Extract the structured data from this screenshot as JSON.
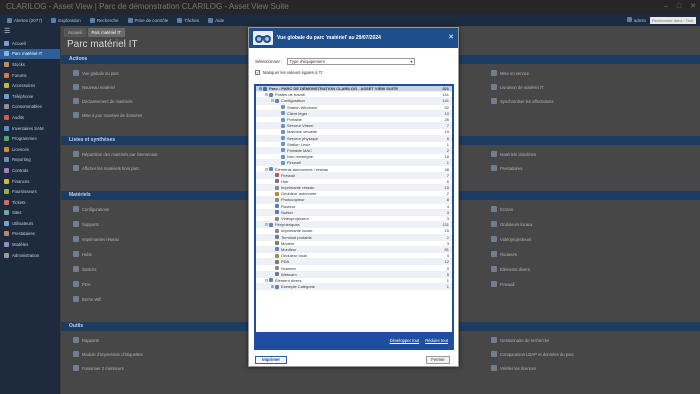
{
  "window": {
    "title": "CLARILOG - Asset View | Parc de démonstration CLARILOG - Asset View Suite"
  },
  "toolbar": {
    "items": [
      "Alertes (2077)",
      "Exploration",
      "Recherche",
      "Prise de contrôle",
      "Tâches",
      "Aide"
    ],
    "user": "admin",
    "search_placeholder": "Rechercher dans : Tout élément"
  },
  "sidebar": {
    "items": [
      {
        "label": "Accueil",
        "color": "#7f9cc0"
      },
      {
        "label": "Parc matériel IT",
        "color": "#8ab0dd"
      },
      {
        "label": "Stocks",
        "color": "#c08a5a"
      },
      {
        "label": "Forums",
        "color": "#d07a45"
      },
      {
        "label": "Accessoires",
        "color": "#c9b14a"
      },
      {
        "label": "Téléphonie",
        "color": "#6aa0c9"
      },
      {
        "label": "Consommables",
        "color": "#8f8f8f"
      },
      {
        "label": "Audits",
        "color": "#cc5c4f"
      },
      {
        "label": "Inventaires SAM",
        "color": "#5e8fc4"
      },
      {
        "label": "Programmes",
        "color": "#5f9f6f"
      },
      {
        "label": "Licences",
        "color": "#c88f3a"
      },
      {
        "label": "Reporting",
        "color": "#6b8fb8"
      },
      {
        "label": "Contrats",
        "color": "#a07fc1"
      },
      {
        "label": "Finances",
        "color": "#d1b34c"
      },
      {
        "label": "Fournisseurs",
        "color": "#8fb05a"
      },
      {
        "label": "Tickets",
        "color": "#cf6b6b"
      },
      {
        "label": "Sites",
        "color": "#6fa7a7"
      },
      {
        "label": "Utilisateurs",
        "color": "#7d9fc8"
      },
      {
        "label": "Prestataires",
        "color": "#b38a6a"
      },
      {
        "label": "Modèles",
        "color": "#8d8dbf"
      },
      {
        "label": "Administration",
        "color": "#9a9a9a"
      }
    ]
  },
  "main": {
    "tabs": [
      "Accueil",
      "Parc matériel IT"
    ],
    "title": "Parc matériel IT",
    "sections": [
      {
        "title": "Actions",
        "left": [
          "Vue globale du parc",
          "Nouveau matériel",
          "Déclassement de matériels",
          "Mise à jour massive de données"
        ],
        "right": [
          "Mise en service",
          "Livraison de matériel IT",
          "Synchroniser les affectations"
        ]
      },
      {
        "title": "Listes et synthèses",
        "left": [
          "Répartition des matériels par intervenant",
          "Afficher les matériels hors parc"
        ],
        "right": [
          "Matériels obsolètes",
          "Prestataires"
        ]
      },
      {
        "title": "Matériels",
        "left": [
          "Configurations",
          "Supports",
          "Imprimantes réseau",
          "Hubs",
          "Switchs",
          "PDA",
          "Borne Wifi"
        ],
        "right": [
          "Écrans",
          "Onduleurs locaux",
          "Vidéoprojecteurs",
          "Routeurs",
          "Éléments divers",
          "Firewall"
        ]
      },
      {
        "title": "Outils",
        "left": [
          "Rapports",
          "Module d'impression d'étiquettes",
          "Fusionner 2 moniteurs"
        ],
        "right": [
          "Gestionnaire de recherche",
          "Comparaison LDAP et données du parc",
          "Vérifier les licences"
        ]
      }
    ]
  },
  "modal": {
    "title": "Vue globale du parc 'matériel' au 29/07/2024",
    "select_label": "Sélectionner :",
    "select_value": "Type d'équipement",
    "checkbox_label": "Masquer les valeurs égales à '0'",
    "checkbox_checked": true,
    "tree": [
      {
        "level": 0,
        "label": "Parc : PARC DE DÉMONSTRATION CLARILOG - ASSET VIEW SUITE",
        "count": "321",
        "toggle": "-",
        "root": true,
        "color": "#3f6fb0"
      },
      {
        "level": 1,
        "label": "Postes de travail",
        "count": "141",
        "toggle": "-",
        "color": "#5c86c0"
      },
      {
        "level": 2,
        "label": "Configuration",
        "count": "141",
        "toggle": "-",
        "color": "#5c86c0"
      },
      {
        "level": 3,
        "label": "Station Windows",
        "count": "52",
        "color": "#6d93c6"
      },
      {
        "level": 3,
        "label": "Client léger",
        "count": "10",
        "color": "#6d93c6"
      },
      {
        "level": 3,
        "label": "Portable",
        "count": "26",
        "color": "#6d93c6"
      },
      {
        "level": 3,
        "label": "Serveur Virtuel",
        "count": "7",
        "color": "#6d93c6"
      },
      {
        "level": 3,
        "label": "Machine virtuelle",
        "count": "19",
        "color": "#6d93c6"
      },
      {
        "level": 3,
        "label": "Serveur physique",
        "count": "6",
        "color": "#6d93c6"
      },
      {
        "level": 3,
        "label": "Station Linux",
        "count": "1",
        "color": "#6d93c6"
      },
      {
        "level": 3,
        "label": "Portable MAC",
        "count": "2",
        "color": "#6d93c6"
      },
      {
        "level": 3,
        "label": "Non renseigné",
        "count": "18",
        "color": "#6d93c6"
      },
      {
        "level": 3,
        "label": "Firewall",
        "count": "1",
        "color": "#6d93c6"
      },
      {
        "level": 1,
        "label": "Éléments autonomes / réseau",
        "count": "48",
        "toggle": "-",
        "color": "#5c86c0"
      },
      {
        "level": 2,
        "label": "Firewall",
        "count": "7",
        "color": "#c45050"
      },
      {
        "level": 2,
        "label": "Hub",
        "count": "6",
        "color": "#7a7a7a"
      },
      {
        "level": 2,
        "label": "Imprimante réseau",
        "count": "15",
        "color": "#8a8a8a"
      },
      {
        "level": 2,
        "label": "Onduleur autonome",
        "count": "2",
        "color": "#b08a3a"
      },
      {
        "level": 2,
        "label": "Photocopieur",
        "count": "8",
        "color": "#8a8a8a"
      },
      {
        "level": 2,
        "label": "Routeur",
        "count": "4",
        "color": "#4f7fb8"
      },
      {
        "level": 2,
        "label": "Switch",
        "count": "3",
        "color": "#4f7fb8"
      },
      {
        "level": 2,
        "label": "Vidéoprojecteur",
        "count": "3",
        "color": "#8a8a8a"
      },
      {
        "level": 1,
        "label": "Périphériques",
        "count": "131",
        "toggle": "-",
        "color": "#5c86c0"
      },
      {
        "level": 2,
        "label": "Imprimante locale",
        "count": "15",
        "color": "#8a8a8a"
      },
      {
        "level": 2,
        "label": "Terminal portable",
        "count": "2",
        "color": "#7a7a7a"
      },
      {
        "level": 2,
        "label": "Modem",
        "count": "3",
        "color": "#7a7a7a"
      },
      {
        "level": 2,
        "label": "Moniteur",
        "count": "81",
        "color": "#5c86c0"
      },
      {
        "level": 2,
        "label": "Onduleur local",
        "count": "4",
        "color": "#b08a3a"
      },
      {
        "level": 2,
        "label": "PDA",
        "count": "12",
        "color": "#7a7a7a"
      },
      {
        "level": 2,
        "label": "Scanner",
        "count": "9",
        "color": "#8a8a8a"
      },
      {
        "level": 2,
        "label": "Webcam",
        "count": "5",
        "color": "#7a7a7a"
      },
      {
        "level": 1,
        "label": "Élément divers",
        "count": "1",
        "toggle": "-",
        "color": "#5c86c0"
      },
      {
        "level": 2,
        "label": "Exemple Catégorie",
        "count": "1",
        "toggle": "+",
        "color": "#5c86c0"
      }
    ],
    "collapse_all": "Développer tout",
    "expand_all": "Réduire tout",
    "print_label": "Imprimer",
    "close_label": "Fermer"
  }
}
